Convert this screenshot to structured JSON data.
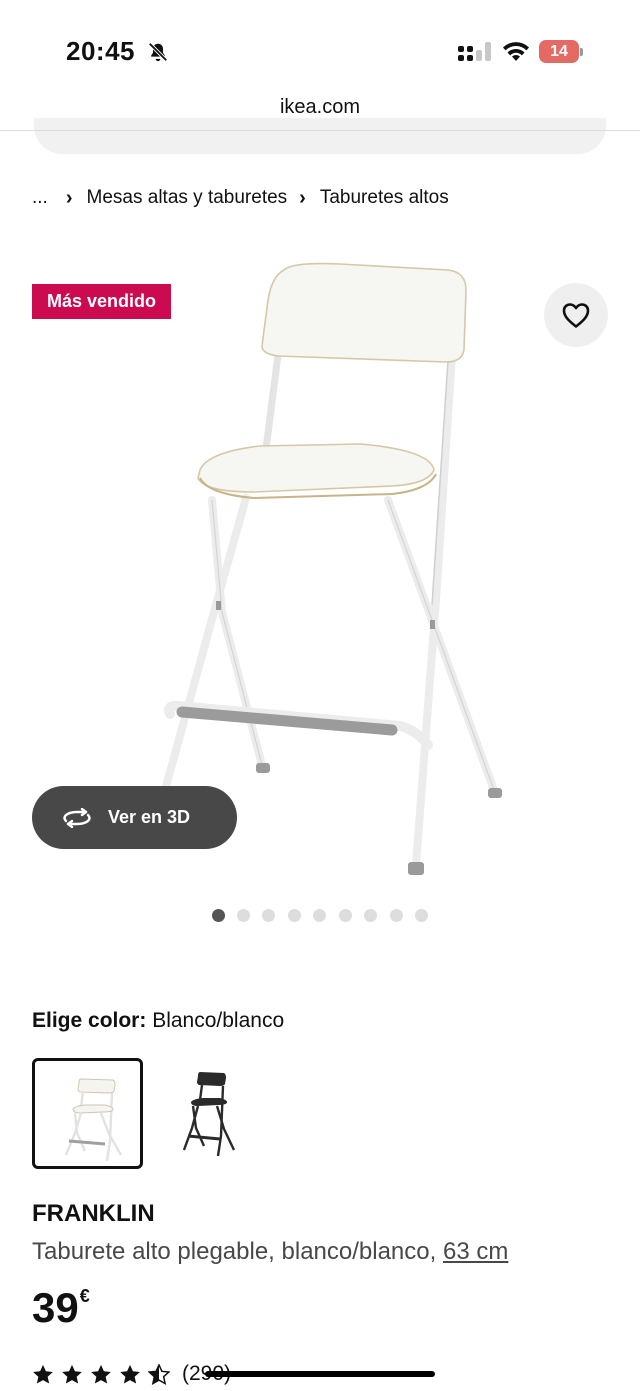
{
  "status_bar": {
    "time": "20:45",
    "battery": "14",
    "battery_color": "#e46a64"
  },
  "browser": {
    "url": "ikea.com"
  },
  "breadcrumb": {
    "ellipsis": "...",
    "items": [
      "Mesas altas y taburetes",
      "Taburetes altos"
    ]
  },
  "product": {
    "badge": "Más vendido",
    "badge_color": "#cc0a4f",
    "view_3d_label": "Ver en 3D",
    "image_count": 9,
    "active_image": 0,
    "color_label": "Elige color:",
    "color_value": "Blanco/blanco",
    "swatches": [
      "white-stool",
      "black-stool"
    ],
    "name": "FRANKLIN",
    "description": "Taburete alto plegable, blanco/blanco,",
    "size_link": "63 cm",
    "price": "39",
    "currency": "€",
    "rating": 4.5,
    "reviews": "(290)"
  },
  "icons": [
    "bell-muted-icon",
    "signal-icon",
    "wifi-icon",
    "battery-icon",
    "heart-icon",
    "rotate-3d-icon",
    "star-icon"
  ]
}
